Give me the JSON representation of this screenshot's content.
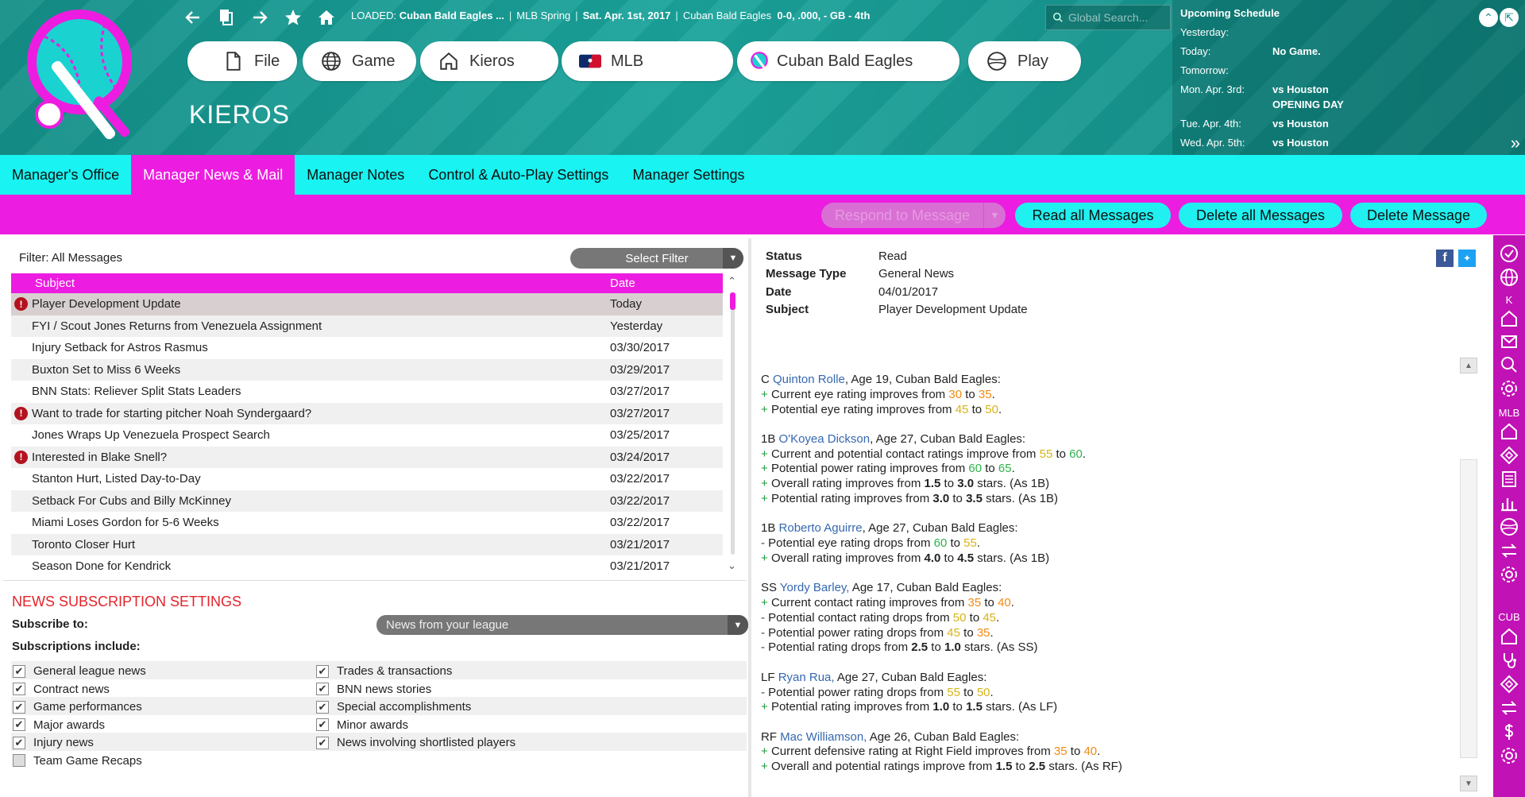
{
  "header": {
    "loaded_label": "LOADED:",
    "loaded_team": "Cuban Bald Eagles ...",
    "league_phase": "MLB Spring",
    "date": "Sat. Apr. 1st, 2017",
    "team_name": "Cuban Bald Eagles",
    "record": "0-0, .000, - GB - 4th",
    "search_placeholder": "Global Search...",
    "page_title": "KIEROS"
  },
  "nav_buttons": [
    {
      "label": "File",
      "icon": "file-icon"
    },
    {
      "label": "Game",
      "icon": "globe-icon"
    },
    {
      "label": "Kieros",
      "icon": "home-icon"
    },
    {
      "label": "MLB",
      "icon": "mlb-logo-icon"
    },
    {
      "label": "Cuban Bald Eagles",
      "icon": "team-logo-icon"
    },
    {
      "label": "Play",
      "icon": "baseball-icon"
    }
  ],
  "schedule": {
    "title": "Upcoming Schedule",
    "rows": [
      {
        "day": "Yesterday:",
        "value": ""
      },
      {
        "day": "Today:",
        "value": "No Game."
      },
      {
        "day": "Tomorrow:",
        "value": ""
      },
      {
        "day": "Mon. Apr. 3rd:",
        "value": "vs Houston"
      },
      {
        "day": "",
        "value": "OPENING DAY"
      },
      {
        "day": "Tue. Apr. 4th:",
        "value": "vs Houston"
      },
      {
        "day": "Wed. Apr. 5th:",
        "value": "vs Houston"
      }
    ]
  },
  "subnav": {
    "tabs": [
      {
        "label": "Manager's Office",
        "active": false
      },
      {
        "label": "Manager News & Mail",
        "active": true
      },
      {
        "label": "Manager Notes",
        "active": false
      },
      {
        "label": "Control & Auto-Play Settings",
        "active": false
      },
      {
        "label": "Manager Settings",
        "active": false
      }
    ]
  },
  "actions": {
    "respond": "Respond to Message",
    "read_all": "Read all Messages",
    "delete_all": "Delete all Messages",
    "delete": "Delete Message"
  },
  "messages": {
    "filter_label": "Filter: All Messages",
    "select_filter": "Select Filter",
    "col_subject": "Subject",
    "col_date": "Date",
    "rows": [
      {
        "subject": "Player Development Update",
        "date": "Today",
        "alert": true,
        "selected": true
      },
      {
        "subject": "FYI / Scout Jones Returns from Venezuela Assignment",
        "date": "Yesterday",
        "alert": false
      },
      {
        "subject": "Injury Setback for Astros Rasmus",
        "date": "03/30/2017",
        "alert": false
      },
      {
        "subject": "Buxton Set to Miss 6 Weeks",
        "date": "03/29/2017",
        "alert": false
      },
      {
        "subject": "BNN Stats: Reliever Split Stats Leaders",
        "date": "03/27/2017",
        "alert": false
      },
      {
        "subject": "Want to trade for starting pitcher Noah Syndergaard?",
        "date": "03/27/2017",
        "alert": true
      },
      {
        "subject": "Jones Wraps Up Venezuela Prospect Search",
        "date": "03/25/2017",
        "alert": false
      },
      {
        "subject": "Interested in Blake Snell?",
        "date": "03/24/2017",
        "alert": true
      },
      {
        "subject": "Stanton Hurt, Listed Day-to-Day",
        "date": "03/22/2017",
        "alert": false
      },
      {
        "subject": "Setback For Cubs and Billy McKinney",
        "date": "03/22/2017",
        "alert": false
      },
      {
        "subject": "Miami Loses Gordon for 5-6 Weeks",
        "date": "03/22/2017",
        "alert": false
      },
      {
        "subject": "Toronto Closer Hurt",
        "date": "03/21/2017",
        "alert": false
      },
      {
        "subject": "Season Done for Kendrick",
        "date": "03/21/2017",
        "alert": false
      }
    ]
  },
  "subscriptions": {
    "title": "NEWS SUBSCRIPTION SETTINGS",
    "subscribe_to_label": "Subscribe to:",
    "subscribe_value": "News from your league",
    "includes_label": "Subscriptions include:",
    "rows": [
      [
        {
          "label": "General league news",
          "checked": true
        },
        {
          "label": "Trades & transactions",
          "checked": true
        }
      ],
      [
        {
          "label": "Contract news",
          "checked": true
        },
        {
          "label": "BNN news stories",
          "checked": true
        }
      ],
      [
        {
          "label": "Game performances",
          "checked": true
        },
        {
          "label": "Special accomplishments",
          "checked": true
        }
      ],
      [
        {
          "label": "Major awards",
          "checked": true
        },
        {
          "label": "Minor awards",
          "checked": true
        }
      ],
      [
        {
          "label": "Injury news",
          "checked": true
        },
        {
          "label": "News involving shortlisted players",
          "checked": true
        }
      ],
      [
        {
          "label": "Team Game Recaps",
          "checked": false
        }
      ]
    ]
  },
  "detail": {
    "status_label": "Status",
    "status": "Read",
    "type_label": "Message Type",
    "type": "General News",
    "date_label": "Date",
    "date": "04/01/2017",
    "subject_label": "Subject",
    "subject": "Player Development Update",
    "players": [
      {
        "pos": "C",
        "name": "Quinton Rolle",
        "info": ", Age 19, Cuban Bald Eagles:",
        "lines": [
          {
            "sign": "+",
            "parts": [
              [
                "Current eye rating improves from ",
                ""
              ],
              [
                "30",
                "org"
              ],
              [
                " to ",
                ""
              ],
              [
                "35",
                "org"
              ],
              [
                ".",
                ""
              ]
            ]
          },
          {
            "sign": "+",
            "parts": [
              [
                "Potential eye rating improves from ",
                ""
              ],
              [
                "45",
                "yel"
              ],
              [
                " to ",
                ""
              ],
              [
                "50",
                "yel"
              ],
              [
                ".",
                ""
              ]
            ]
          }
        ]
      },
      {
        "pos": "1B",
        "name": "O'Koyea Dickson",
        "info": ", Age 27, Cuban Bald Eagles:",
        "lines": [
          {
            "sign": "+",
            "parts": [
              [
                "Current and potential contact ratings improve from ",
                ""
              ],
              [
                "55",
                "yel"
              ],
              [
                " to ",
                ""
              ],
              [
                "60",
                "grn"
              ],
              [
                ".",
                ""
              ]
            ]
          },
          {
            "sign": "+",
            "parts": [
              [
                "Potential power rating improves from ",
                ""
              ],
              [
                "60",
                "grn"
              ],
              [
                " to ",
                ""
              ],
              [
                "65",
                "grn"
              ],
              [
                ".",
                ""
              ]
            ]
          },
          {
            "sign": "+",
            "parts": [
              [
                "Overall rating improves from ",
                ""
              ],
              [
                "1.5",
                "b"
              ],
              [
                " to ",
                ""
              ],
              [
                "3.0",
                "b"
              ],
              [
                " stars. (As 1B)",
                ""
              ]
            ]
          },
          {
            "sign": "+",
            "parts": [
              [
                "Potential rating improves from ",
                ""
              ],
              [
                "3.0",
                "b"
              ],
              [
                " to ",
                ""
              ],
              [
                "3.5",
                "b"
              ],
              [
                " stars. (As 1B)",
                ""
              ]
            ]
          }
        ]
      },
      {
        "pos": "1B",
        "name": "Roberto Aguirre",
        "info": ", Age 27, Cuban Bald Eagles:",
        "lines": [
          {
            "sign": "-",
            "parts": [
              [
                "Potential eye rating drops from ",
                ""
              ],
              [
                "60",
                "grn"
              ],
              [
                " to ",
                ""
              ],
              [
                "55",
                "yel"
              ],
              [
                ".",
                ""
              ]
            ]
          },
          {
            "sign": "+",
            "parts": [
              [
                "Overall rating improves from ",
                ""
              ],
              [
                "4.0",
                "b"
              ],
              [
                " to ",
                ""
              ],
              [
                "4.5",
                "b"
              ],
              [
                " stars. (As 1B)",
                ""
              ]
            ]
          }
        ]
      },
      {
        "pos": "SS",
        "name": "Yordy Barley,",
        "info": " Age 17, Cuban Bald Eagles:",
        "lines": [
          {
            "sign": "+",
            "parts": [
              [
                "Current contact rating improves from ",
                ""
              ],
              [
                "35",
                "org"
              ],
              [
                " to ",
                ""
              ],
              [
                "40",
                "org"
              ],
              [
                ".",
                ""
              ]
            ]
          },
          {
            "sign": "-",
            "parts": [
              [
                "Potential contact rating drops from ",
                ""
              ],
              [
                "50",
                "yel"
              ],
              [
                " to ",
                ""
              ],
              [
                "45",
                "yel"
              ],
              [
                ".",
                ""
              ]
            ]
          },
          {
            "sign": "-",
            "parts": [
              [
                "Potential power rating drops from ",
                ""
              ],
              [
                "45",
                "yel"
              ],
              [
                " to ",
                ""
              ],
              [
                "35",
                "org"
              ],
              [
                ".",
                ""
              ]
            ]
          },
          {
            "sign": "-",
            "parts": [
              [
                "Potential rating drops from ",
                ""
              ],
              [
                "2.5",
                "b"
              ],
              [
                " to ",
                ""
              ],
              [
                "1.0",
                "b"
              ],
              [
                " stars. (As SS)",
                ""
              ]
            ]
          }
        ]
      },
      {
        "pos": "LF",
        "name": "Ryan Rua,",
        "info": " Age 27, Cuban Bald Eagles:",
        "lines": [
          {
            "sign": "-",
            "parts": [
              [
                "Potential power rating drops from ",
                ""
              ],
              [
                "55",
                "yel"
              ],
              [
                " to ",
                ""
              ],
              [
                "50",
                "yel"
              ],
              [
                ".",
                ""
              ]
            ]
          },
          {
            "sign": "+",
            "parts": [
              [
                "Potential rating improves from ",
                ""
              ],
              [
                "1.0",
                "b"
              ],
              [
                " to ",
                ""
              ],
              [
                "1.5",
                "b"
              ],
              [
                " stars. (As LF)",
                ""
              ]
            ]
          }
        ]
      },
      {
        "pos": "RF",
        "name": "Mac Williamson,",
        "info": " Age 26, Cuban Bald Eagles:",
        "lines": [
          {
            "sign": "+",
            "parts": [
              [
                "Current defensive rating at Right Field improves from ",
                ""
              ],
              [
                "35",
                "org"
              ],
              [
                " to ",
                ""
              ],
              [
                "40",
                "org"
              ],
              [
                ".",
                ""
              ]
            ]
          },
          {
            "sign": "+",
            "parts": [
              [
                "Overall and potential ratings improve from ",
                ""
              ],
              [
                "1.5",
                "b"
              ],
              [
                " to ",
                ""
              ],
              [
                "2.5",
                "b"
              ],
              [
                " stars. (As RF)",
                ""
              ]
            ]
          }
        ]
      }
    ]
  },
  "sidebar": {
    "section_labels": [
      "K",
      "MLB",
      "CUB"
    ]
  },
  "colors": {
    "teal": "#148f88",
    "cyan": "#19f3f1",
    "magenta": "#ec1de0",
    "sidebar": "#c112b5"
  }
}
